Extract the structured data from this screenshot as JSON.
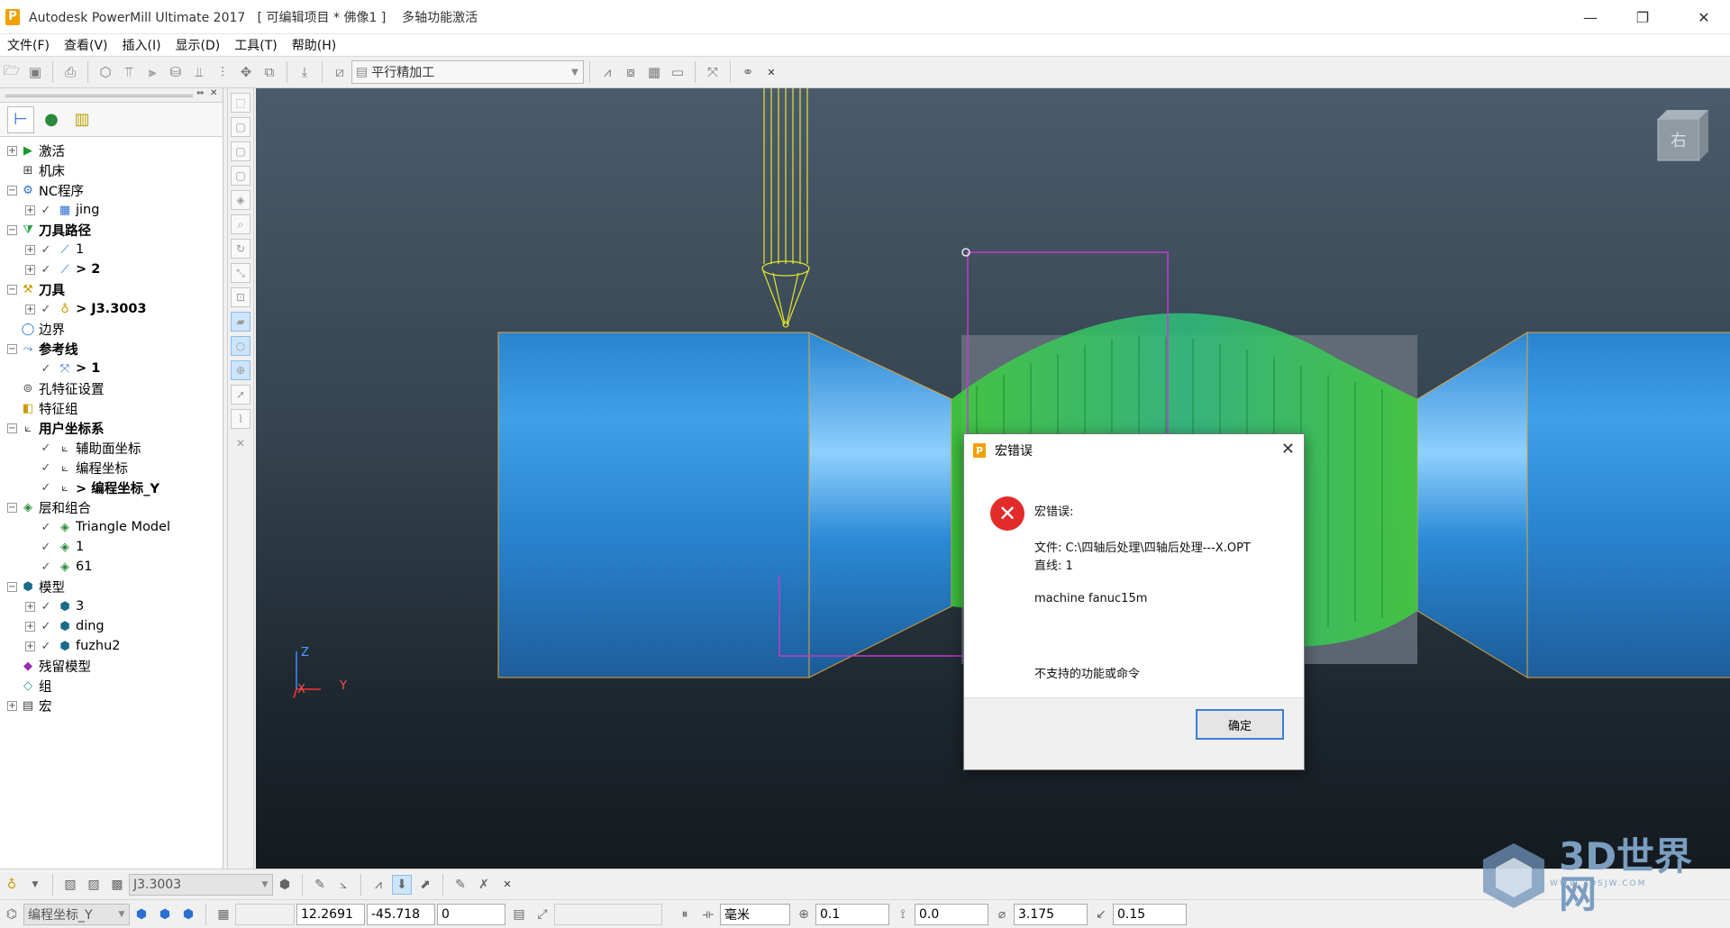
{
  "titlebar": {
    "title": "Autodesk PowerMill Ultimate 2017   [ 可编辑项目 * 佛像1 ]    多轴功能激活"
  },
  "menu": [
    "文件(F)",
    "查看(V)",
    "插入(I)",
    "显示(D)",
    "工具(T)",
    "帮助(H)"
  ],
  "toolbar": {
    "strategy_value": "平行精加工"
  },
  "tree": [
    {
      "label": "激活",
      "expand": "+",
      "icon": "activate-icon",
      "bold": false,
      "indent": 0
    },
    {
      "label": "机床",
      "expand": "",
      "icon": "machine-icon",
      "bold": false,
      "indent": 0
    },
    {
      "label": "NC程序",
      "expand": "-",
      "icon": "nc-program-icon",
      "bold": false,
      "indent": 0
    },
    {
      "label": "jing",
      "expand": "+",
      "icon": "nc-item-icon",
      "bold": false,
      "indent": 1
    },
    {
      "label": "刀具路径",
      "expand": "-",
      "icon": "toolpath-icon",
      "bold": true,
      "indent": 0
    },
    {
      "label": "1",
      "expand": "+",
      "icon": "toolpath-item-icon",
      "bold": false,
      "indent": 1
    },
    {
      "label": "> 2",
      "expand": "+",
      "icon": "toolpath-item-icon",
      "bold": true,
      "indent": 1
    },
    {
      "label": "刀具",
      "expand": "-",
      "icon": "tool-icon",
      "bold": true,
      "indent": 0
    },
    {
      "label": "> J3.3003",
      "expand": "+",
      "icon": "tool-item-icon",
      "bold": true,
      "indent": 1
    },
    {
      "label": "边界",
      "expand": "",
      "icon": "boundary-icon",
      "bold": false,
      "indent": 0
    },
    {
      "label": "参考线",
      "expand": "-",
      "icon": "pattern-icon",
      "bold": true,
      "indent": 0
    },
    {
      "label": "> 1",
      "expand": "",
      "icon": "pattern-item-icon",
      "bold": true,
      "indent": 1
    },
    {
      "label": "孔特征设置",
      "expand": "",
      "icon": "hole-feature-icon",
      "bold": false,
      "indent": 0
    },
    {
      "label": "特征组",
      "expand": "",
      "icon": "feature-group-icon",
      "bold": false,
      "indent": 0
    },
    {
      "label": "用户坐标系",
      "expand": "-",
      "icon": "workplane-icon",
      "bold": true,
      "indent": 0
    },
    {
      "label": "辅助面坐标",
      "expand": "",
      "icon": "workplane-item-icon",
      "bold": false,
      "indent": 1
    },
    {
      "label": "编程坐标",
      "expand": "",
      "icon": "workplane-item-icon",
      "bold": false,
      "indent": 1
    },
    {
      "label": "> 编程坐标_Y",
      "expand": "",
      "icon": "workplane-item-icon",
      "bold": true,
      "indent": 1
    },
    {
      "label": "层和组合",
      "expand": "-",
      "icon": "levels-icon",
      "bold": false,
      "indent": 0
    },
    {
      "label": "Triangle Model",
      "expand": "",
      "icon": "level-item-icon",
      "bold": false,
      "indent": 1
    },
    {
      "label": "1",
      "expand": "",
      "icon": "level-item-icon",
      "bold": false,
      "indent": 1
    },
    {
      "label": "61",
      "expand": "",
      "icon": "level-item-icon",
      "bold": false,
      "indent": 1
    },
    {
      "label": "模型",
      "expand": "-",
      "icon": "model-icon",
      "bold": false,
      "indent": 0
    },
    {
      "label": "3",
      "expand": "+",
      "icon": "model-item-icon",
      "bold": false,
      "indent": 1
    },
    {
      "label": "ding",
      "expand": "+",
      "icon": "model-item-icon",
      "bold": false,
      "indent": 1
    },
    {
      "label": "fuzhu2",
      "expand": "+",
      "icon": "model-item-icon",
      "bold": false,
      "indent": 1
    },
    {
      "label": "残留模型",
      "expand": "",
      "icon": "stock-model-icon",
      "bold": false,
      "indent": 0
    },
    {
      "label": "组",
      "expand": "",
      "icon": "group-icon",
      "bold": false,
      "indent": 0
    },
    {
      "label": "宏",
      "expand": "+",
      "icon": "macro-icon",
      "bold": false,
      "indent": 0
    }
  ],
  "viewcube": {
    "face_label": "右"
  },
  "axes": {
    "z": "Z",
    "x": "X",
    "y": "Y"
  },
  "dialog": {
    "title": "宏错误",
    "heading": "宏错误:",
    "file_line": "文件: C:\\四轴后处理\\四轴后处理---X.OPT",
    "line_line": "直线: 1",
    "command": "machine fanuc15m",
    "message": "不支持的功能或命令",
    "ok_label": "确定"
  },
  "bottom_toolbar": {
    "tool_value": "J3.3003"
  },
  "status": {
    "workplane_value": "编程坐标_Y",
    "coord_x": "12.2691",
    "coord_y": "-45.718",
    "coord_z": "0",
    "units": "毫米",
    "tolerance": "0.1",
    "thickness": "0.0",
    "diameter": "3.175",
    "stepover": "0.15"
  },
  "watermark": {
    "text": "3D世界网",
    "sub": "WWW.3DSJW.COM"
  },
  "colors": {
    "accent": "#3c7fd6",
    "error": "#e22c2c",
    "part_blue": "#2f8fd8",
    "toolpath_green": "#3fd23a",
    "tool_yellow": "#e6e62a",
    "boundary_magenta": "#c03cc8"
  }
}
